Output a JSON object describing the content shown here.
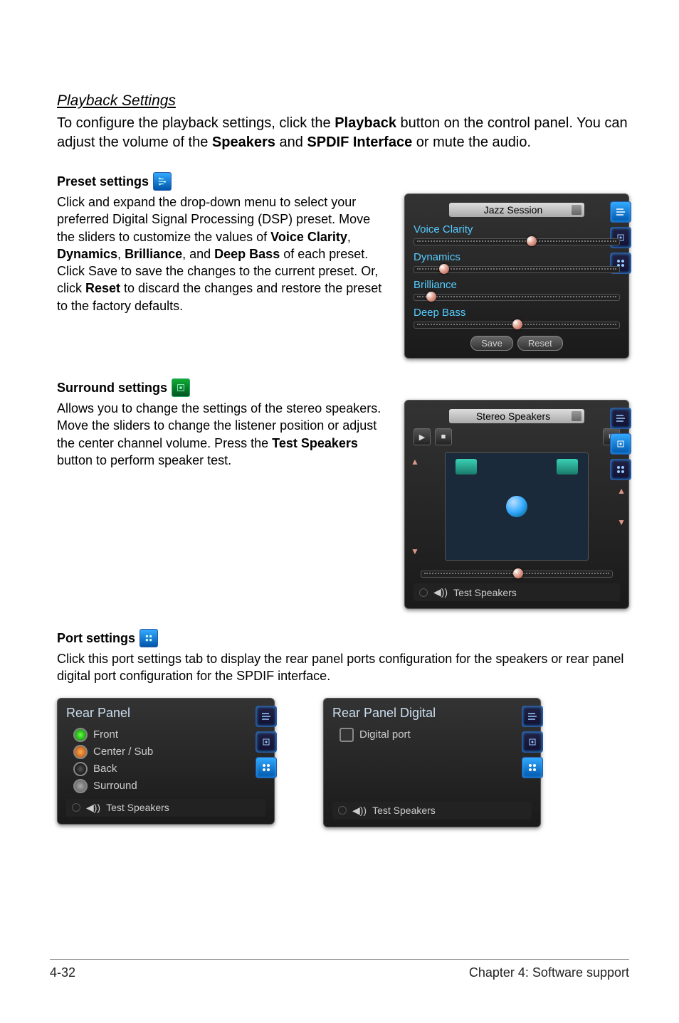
{
  "playback": {
    "heading": "Playback Settings",
    "intro_pre": "To configure the playback settings, click the ",
    "intro_b1": "Playback",
    "intro_mid1": " button on the control panel. You can adjust the volume of the ",
    "intro_b2": "Speakers",
    "intro_mid2": " and ",
    "intro_b3": "SPDIF Interface",
    "intro_end": " or mute the audio."
  },
  "preset": {
    "title": "Preset settings",
    "p_pre": "Click and expand the drop-down menu to select your preferred Digital Signal Processing (DSP) preset. Move the sliders to customize the values of ",
    "b1": "Voice Clarity",
    "s1": ", ",
    "b2": "Dynamics",
    "s2": ", ",
    "b3": "Brilliance",
    "s3": ", and ",
    "b4": "Deep Bass",
    "p_mid": " of each preset. Click Save to save the changes to the current preset. Or, click ",
    "b5": "Reset",
    "p_end": " to discard the changes and restore the preset to the factory defaults.",
    "panel": {
      "dropdown": "Jazz Session",
      "sliders": {
        "voice": "Voice Clarity",
        "dyn": "Dynamics",
        "bri": "Brilliance",
        "bass": "Deep Bass"
      },
      "save": "Save",
      "reset": "Reset"
    }
  },
  "surround": {
    "title": "Surround settings",
    "p_pre": "Allows you to change the settings of the stereo speakers. Move the sliders to change the listener position or adjust the center channel volume. Press the ",
    "b1": "Test Speakers",
    "p_end": " button to perform speaker test.",
    "panel": {
      "dropdown": "Stereo Speakers",
      "test": "Test Speakers"
    }
  },
  "port": {
    "title": "Port settings",
    "p": "Click this port settings tab to display the rear panel ports configuration for the speakers or rear panel digital port configuration for the SPDIF interface.",
    "left": {
      "title": "Rear Panel",
      "front": "Front",
      "center": "Center / Sub",
      "back": "Back",
      "surround": "Surround",
      "test": "Test Speakers"
    },
    "right": {
      "title": "Rear Panel Digital",
      "digital": "Digital port",
      "test": "Test Speakers"
    }
  },
  "footer": {
    "left": "4-32",
    "right": "Chapter 4: Software support"
  }
}
